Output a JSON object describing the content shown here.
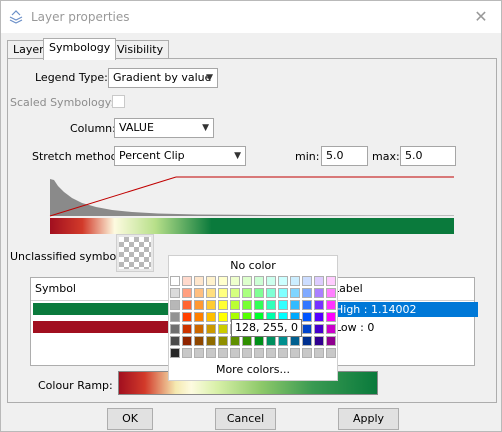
{
  "window": {
    "title": "Layer properties",
    "close_glyph": "✕",
    "app_icon": "layers-icon"
  },
  "tabs": [
    {
      "label": "Layer"
    },
    {
      "label": "Symbology"
    },
    {
      "label": "Visibility"
    }
  ],
  "form": {
    "legend_type_label": "Legend Type:",
    "legend_type_value": "Gradient by value",
    "scaled_label": "Scaled Symbology:",
    "column_label": "Column:",
    "column_value": "VALUE",
    "stretch_label": "Stretch method:",
    "stretch_value": "Percent Clip",
    "min_label": "min:",
    "min_value": "5.0",
    "max_label": "max:",
    "max_value": "5.0",
    "unclassified_label": "Unclassified symbol:",
    "ramp_label": "Colour Ramp:"
  },
  "table": {
    "headers": [
      "Symbol",
      "Label"
    ],
    "rows": [
      {
        "color": "#0a7a3c",
        "label": "High : 1.14002",
        "selected": true
      },
      {
        "color": "#a10f1f",
        "label": "Low : 0",
        "selected": false
      }
    ]
  },
  "color_popup": {
    "no_color": "No color",
    "more_colors": "More colors...",
    "tooltip": "128, 255, 0"
  },
  "buttons": {
    "ok": "OK",
    "cancel": "Cancel",
    "apply": "Apply"
  }
}
